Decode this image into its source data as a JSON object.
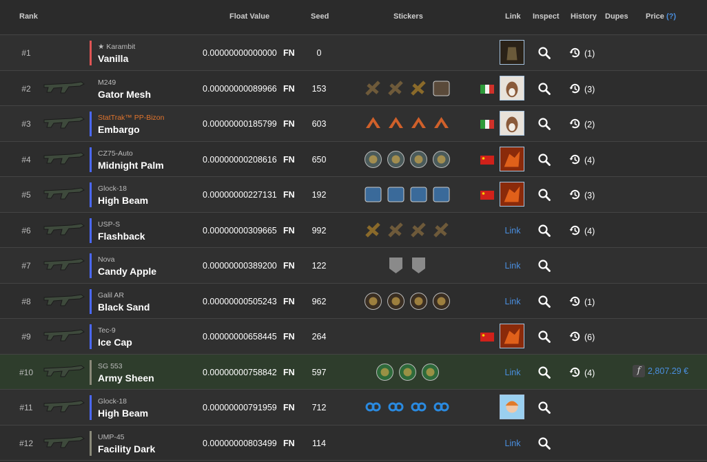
{
  "colors": {
    "accent": "#4a8fe0",
    "stattrak": "#e0742d",
    "highlight_row": "#2e3d2c",
    "rarity_red": "#e05555",
    "rarity_blue": "#4b69ff",
    "rarity_gray": "#8a8a7a"
  },
  "header": {
    "rank": "Rank",
    "float": "Float Value",
    "seed": "Seed",
    "stickers": "Stickers",
    "link": "Link",
    "inspect": "Inspect",
    "history": "History",
    "dupes": "Dupes",
    "price": "Price",
    "price_help": "(?)"
  },
  "rows": [
    {
      "rank": "#1",
      "type": "★ Karambit",
      "name": "Vanilla",
      "float": "0.00000000000000",
      "wear": "FN",
      "seed": "0",
      "history": "(1)",
      "rarity": "red",
      "stickers": [],
      "link": "avatar",
      "avatar": "knight",
      "flag": ""
    },
    {
      "rank": "#2",
      "type": "M249",
      "name": "Gator Mesh",
      "float": "0.00000000089966",
      "wear": "FN",
      "seed": "153",
      "history": "(3)",
      "rarity": "none",
      "stickers": [
        "crown",
        "crown",
        "gold",
        "tag"
      ],
      "link": "avatar",
      "avatar": "dog",
      "flag": "it"
    },
    {
      "rank": "#3",
      "type": "StatTrak™ PP-Bizon",
      "name": "Embargo",
      "float": "0.00000000185799",
      "wear": "FN",
      "seed": "603",
      "history": "(2)",
      "rarity": "blue",
      "stattrak": true,
      "stickers": [
        "orange",
        "orange",
        "orange",
        "orange"
      ],
      "link": "avatar",
      "avatar": "dog",
      "flag": "it"
    },
    {
      "rank": "#4",
      "type": "CZ75-Auto",
      "name": "Midnight Palm",
      "float": "0.00000000208616",
      "wear": "FN",
      "seed": "650",
      "history": "(4)",
      "rarity": "blue",
      "stickers": [
        "round",
        "round",
        "round",
        "round"
      ],
      "link": "avatar",
      "avatar": "dragon",
      "flag": "cn"
    },
    {
      "rank": "#5",
      "type": "Glock-18",
      "name": "High Beam",
      "float": "0.00000000227131",
      "wear": "FN",
      "seed": "192",
      "history": "(3)",
      "rarity": "blue",
      "stickers": [
        "blue",
        "blue",
        "blue",
        "blue"
      ],
      "link": "avatar",
      "avatar": "dragon",
      "flag": "cn"
    },
    {
      "rank": "#6",
      "type": "USP-S",
      "name": "Flashback",
      "float": "0.00000000309665",
      "wear": "FN",
      "seed": "992",
      "history": "(4)",
      "rarity": "blue",
      "stickers": [
        "gold",
        "crown",
        "crown",
        "crown"
      ],
      "link": "text",
      "link_label": "Link",
      "flag": ""
    },
    {
      "rank": "#7",
      "type": "Nova",
      "name": "Candy Apple",
      "float": "0.00000000389200",
      "wear": "FN",
      "seed": "122",
      "history": "",
      "rarity": "blue",
      "stickers": [
        "shield",
        "shield"
      ],
      "link": "text",
      "link_label": "Link",
      "flag": ""
    },
    {
      "rank": "#8",
      "type": "Galil AR",
      "name": "Black Sand",
      "float": "0.00000000505243",
      "wear": "FN",
      "seed": "962",
      "history": "(1)",
      "rarity": "blue",
      "stickers": [
        "dark",
        "dark",
        "dark",
        "dark"
      ],
      "link": "text",
      "link_label": "Link",
      "flag": ""
    },
    {
      "rank": "#9",
      "type": "Tec-9",
      "name": "Ice Cap",
      "float": "0.00000000658445",
      "wear": "FN",
      "seed": "264",
      "history": "(6)",
      "rarity": "blue",
      "stickers": [],
      "link": "avatar",
      "avatar": "dragon",
      "flag": "cn"
    },
    {
      "rank": "#10",
      "type": "SG 553",
      "name": "Army Sheen",
      "float": "0.00000000758842",
      "wear": "FN",
      "seed": "597",
      "history": "(4)",
      "rarity": "gray",
      "highlight": true,
      "stickers": [
        "green",
        "green",
        "green"
      ],
      "link": "text",
      "link_label": "Link",
      "flag": "",
      "price": "2,807.29 €",
      "price_icon": "f"
    },
    {
      "rank": "#11",
      "type": "Glock-18",
      "name": "High Beam",
      "float": "0.00000000791959",
      "wear": "FN",
      "seed": "712",
      "history": "",
      "rarity": "blue",
      "stickers": [
        "cloud9",
        "cloud9",
        "cloud9",
        "cloud9"
      ],
      "link": "avatar",
      "avatar": "anime",
      "flag": ""
    },
    {
      "rank": "#12",
      "type": "UMP-45",
      "name": "Facility Dark",
      "float": "0.00000000803499",
      "wear": "FN",
      "seed": "114",
      "history": "",
      "rarity": "gray",
      "stickers": [],
      "link": "text",
      "link_label": "Link",
      "flag": ""
    }
  ]
}
